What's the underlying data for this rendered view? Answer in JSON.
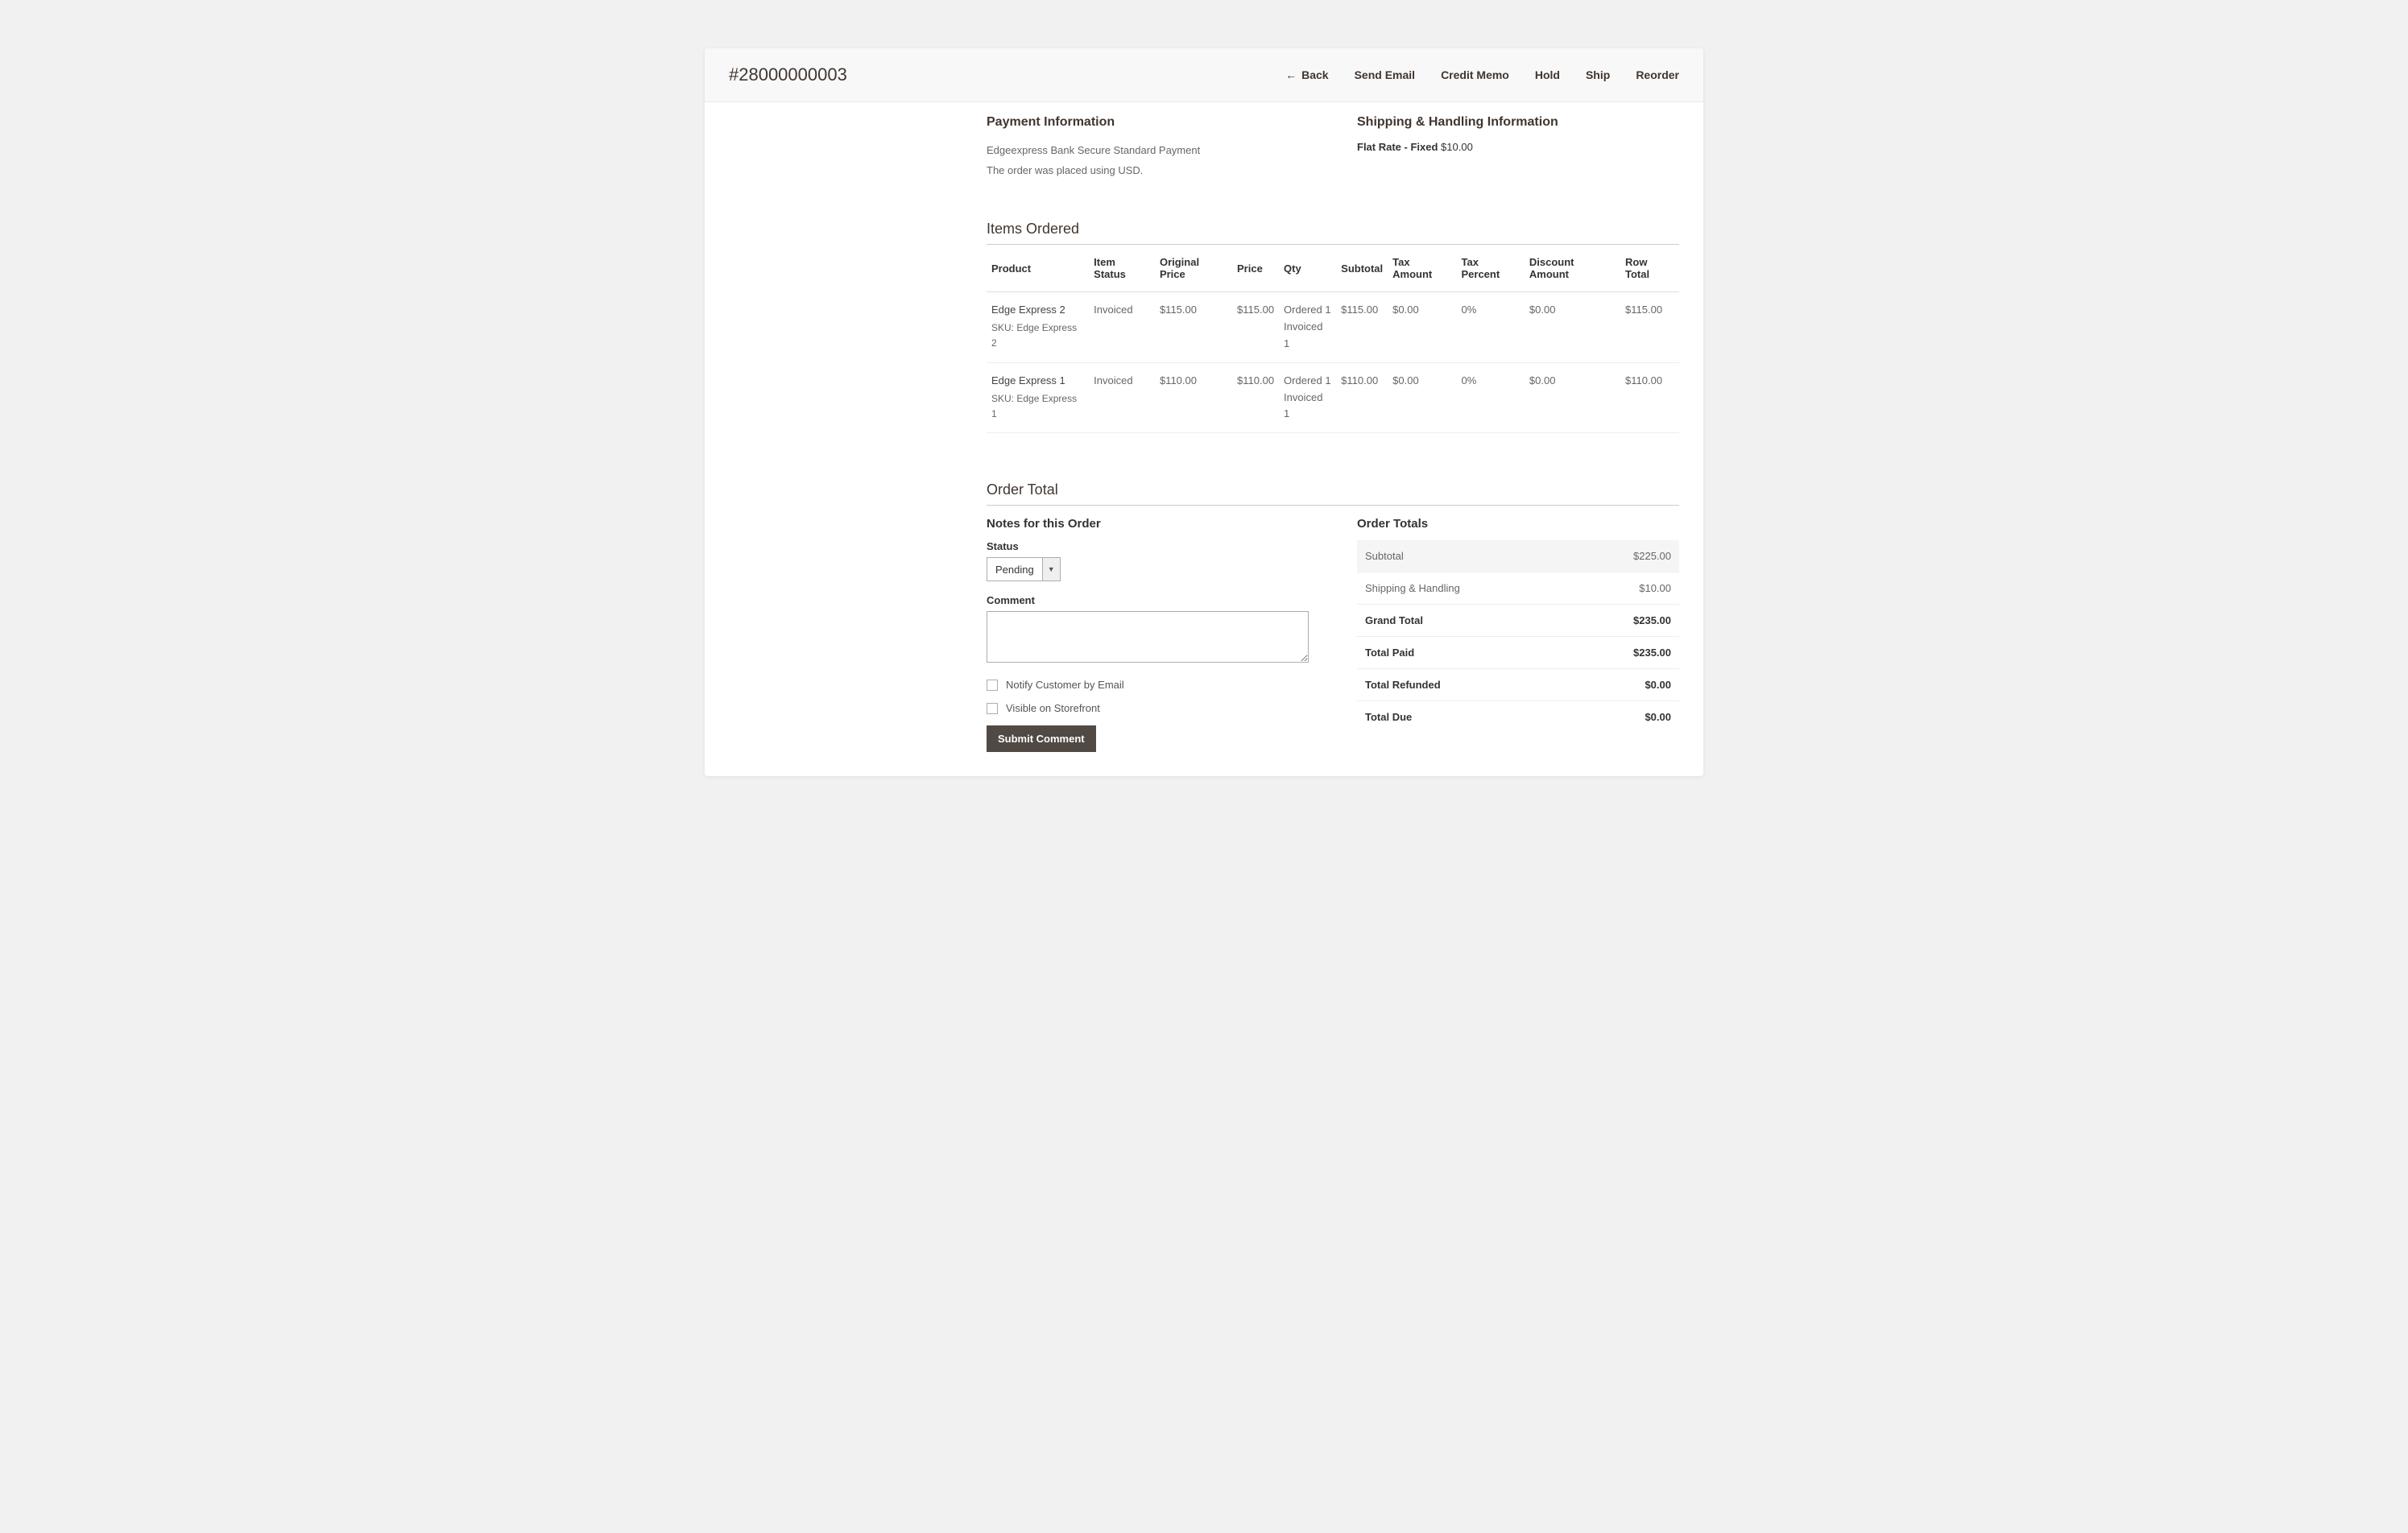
{
  "header": {
    "order_id": "#28000000003",
    "actions": {
      "back": "Back",
      "send_email": "Send Email",
      "credit_memo": "Credit Memo",
      "hold": "Hold",
      "ship": "Ship",
      "reorder": "Reorder"
    }
  },
  "payment": {
    "heading": "Payment Information",
    "method": "Edgeexpress Bank Secure Standard Payment",
    "currency_note": "The order was placed using USD."
  },
  "shipping": {
    "heading": "Shipping & Handling Information",
    "label": "Flat Rate - Fixed",
    "amount": "$10.00"
  },
  "items_section": {
    "heading": "Items Ordered",
    "columns": {
      "product": "Product",
      "item_status": "Item Status",
      "original_price": "Original Price",
      "price": "Price",
      "qty": "Qty",
      "subtotal": "Subtotal",
      "tax_amount": "Tax Amount",
      "tax_percent": "Tax Percent",
      "discount_amount": "Discount Amount",
      "row_total": "Row Total"
    },
    "sku_label": "SKU:",
    "rows": [
      {
        "name": "Edge Express 2",
        "sku": "Edge Express 2",
        "status": "Invoiced",
        "original_price": "$115.00",
        "price": "$115.00",
        "qty_ordered": "Ordered 1",
        "qty_invoiced": "Invoiced 1",
        "subtotal": "$115.00",
        "tax_amount": "$0.00",
        "tax_percent": "0%",
        "discount": "$0.00",
        "row_total": "$115.00"
      },
      {
        "name": "Edge Express 1",
        "sku": "Edge Express 1",
        "status": "Invoiced",
        "original_price": "$110.00",
        "price": "$110.00",
        "qty_ordered": "Ordered 1",
        "qty_invoiced": "Invoiced 1",
        "subtotal": "$110.00",
        "tax_amount": "$0.00",
        "tax_percent": "0%",
        "discount": "$0.00",
        "row_total": "$110.00"
      }
    ]
  },
  "order_total": {
    "heading": "Order Total",
    "notes_heading": "Notes for this Order",
    "status_label": "Status",
    "status_value": "Pending",
    "comment_label": "Comment",
    "comment_value": "",
    "notify_label": "Notify Customer by Email",
    "visible_label": "Visible on Storefront",
    "submit_label": "Submit Comment",
    "totals_heading": "Order Totals",
    "totals": {
      "subtotal_label": "Subtotal",
      "subtotal_value": "$225.00",
      "shipping_label": "Shipping & Handling",
      "shipping_value": "$10.00",
      "grand_total_label": "Grand Total",
      "grand_total_value": "$235.00",
      "total_paid_label": "Total Paid",
      "total_paid_value": "$235.00",
      "total_refunded_label": "Total Refunded",
      "total_refunded_value": "$0.00",
      "total_due_label": "Total Due",
      "total_due_value": "$0.00"
    }
  }
}
